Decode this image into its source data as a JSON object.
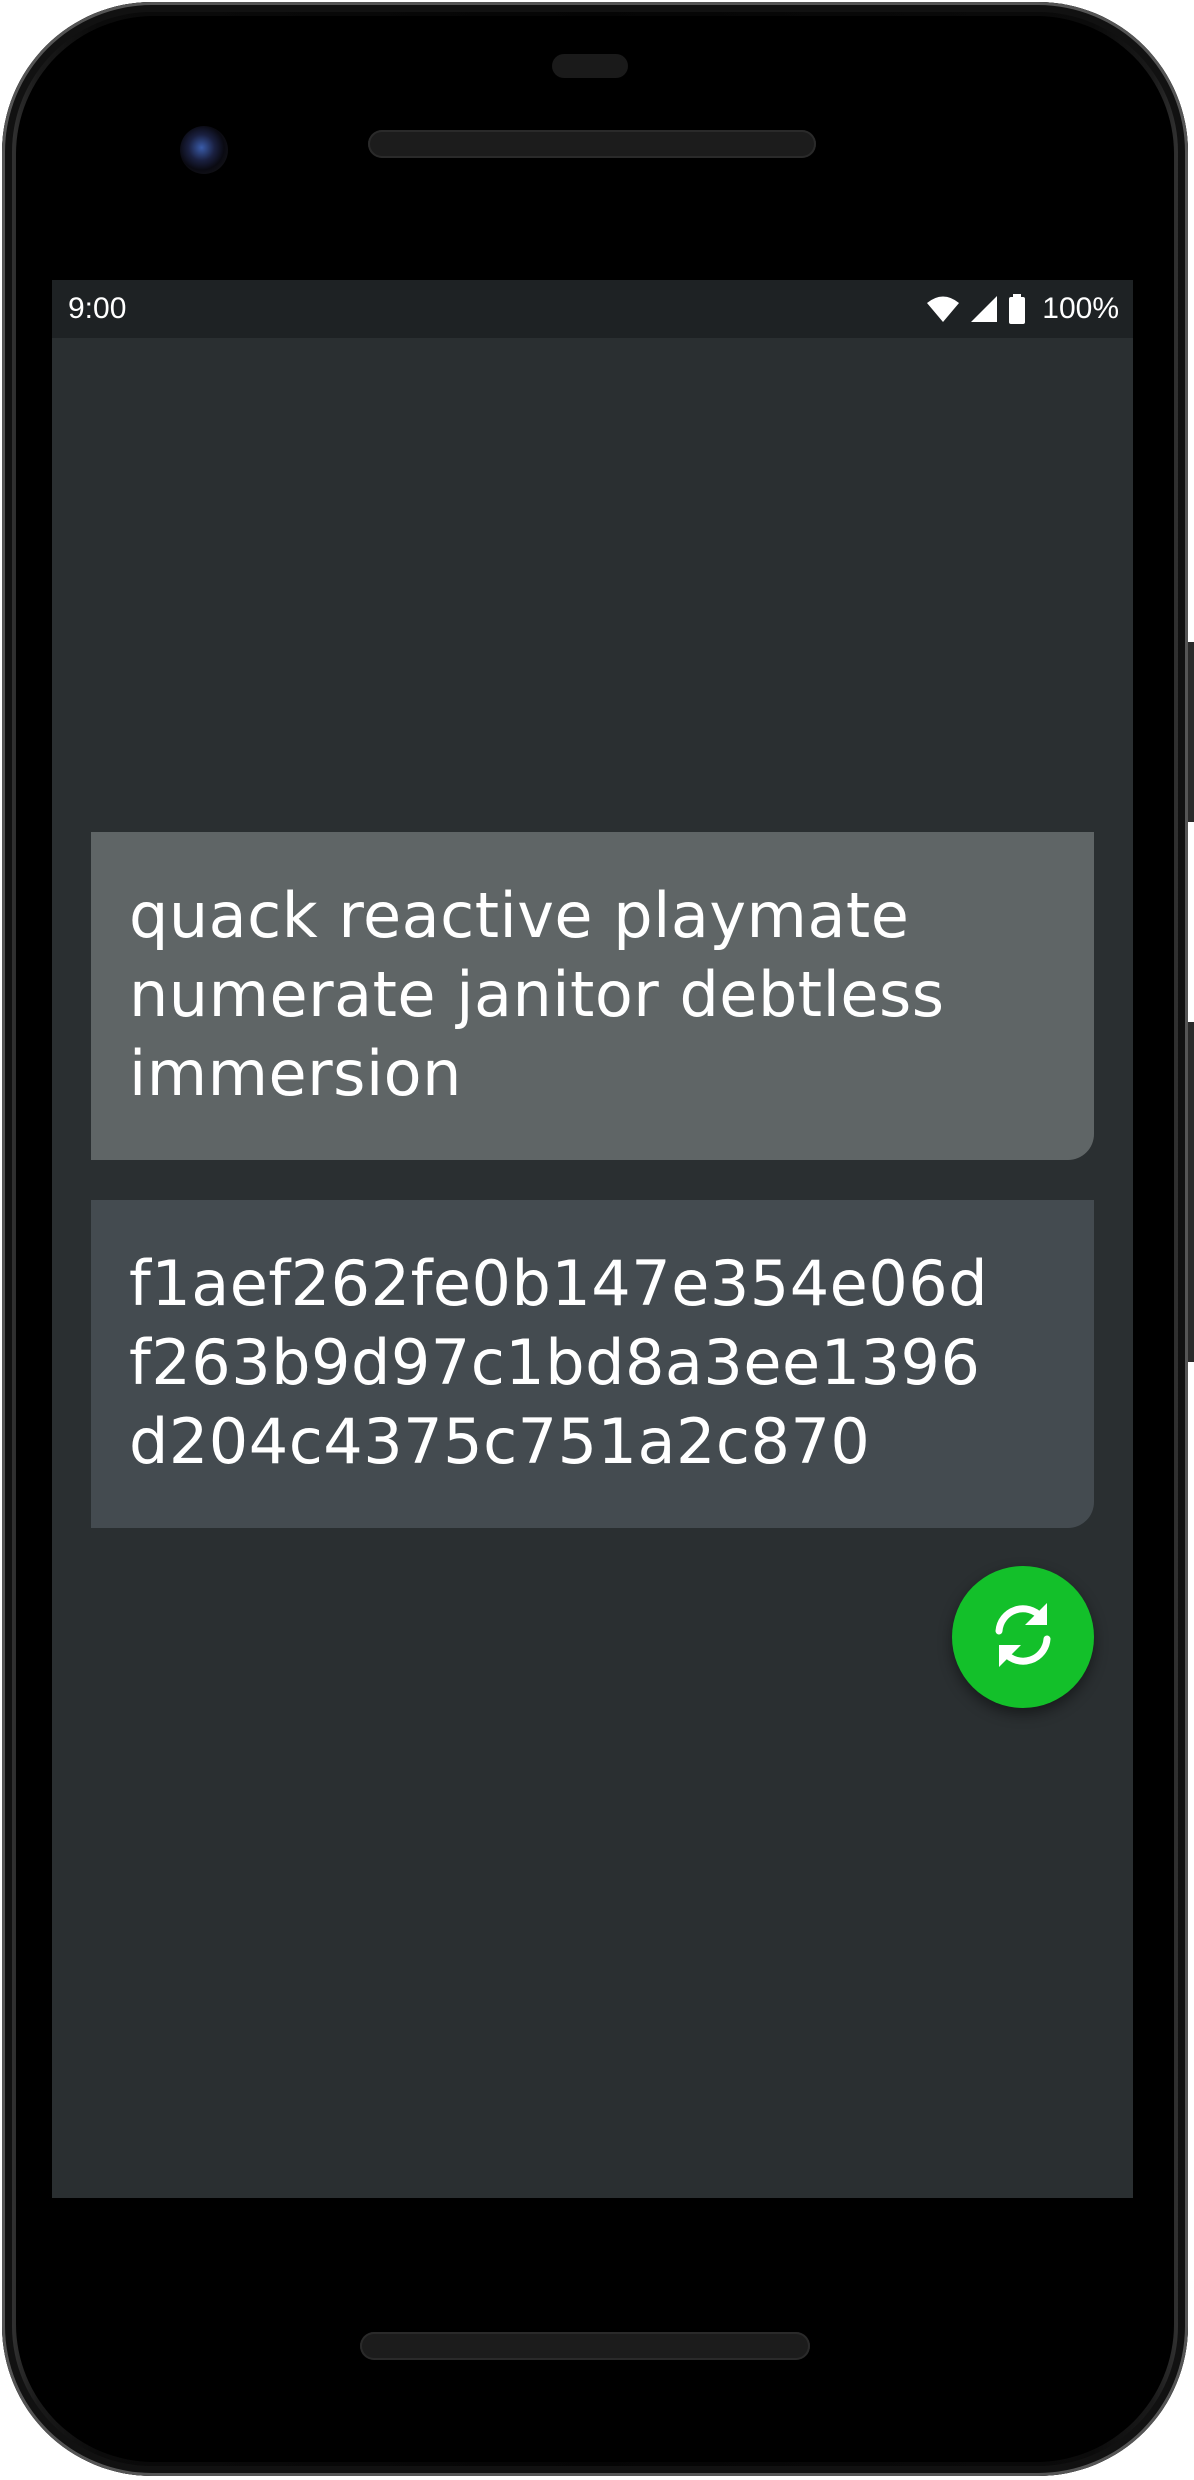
{
  "status_bar": {
    "time": "9:00",
    "battery_text": "100%",
    "icons": [
      "wifi-icon",
      "cell-signal-icon",
      "battery-icon"
    ]
  },
  "passphrase": {
    "lines": [
      "quack reactive playmate",
      "numerate janitor debtless",
      "immersion"
    ]
  },
  "hash": {
    "lines": [
      "f1aef262fe0b147e354e06d",
      "f263b9d97c1bd8a3ee1396",
      "d204c4375c751a2c870"
    ]
  },
  "refresh_button": {
    "icon": "refresh-icon"
  },
  "colors": {
    "screen_background": "#2a2f31",
    "status_bar_background": "#1e2224",
    "passphrase_card": "#5f6566",
    "hash_card": "#444b50",
    "fab": "#13c02a"
  }
}
